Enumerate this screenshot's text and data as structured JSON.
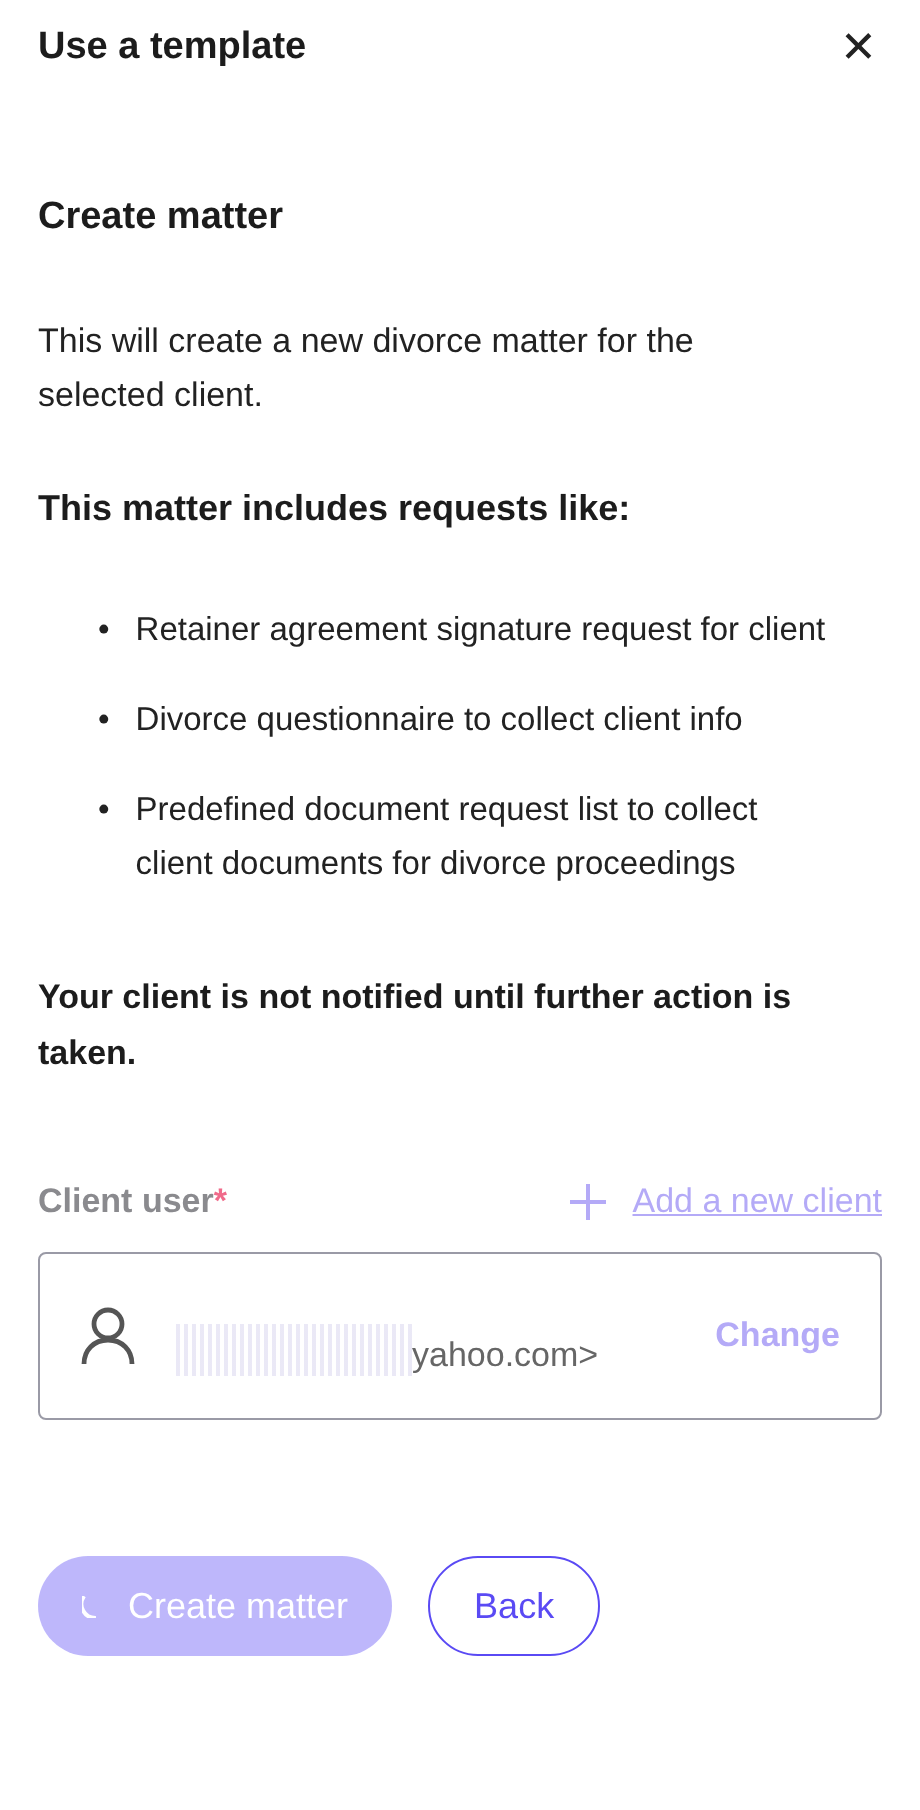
{
  "header": {
    "title": "Use a template",
    "close_icon": "✕"
  },
  "section_title": "Create matter",
  "description": "This will create a new divorce matter for the selected client.",
  "includes_heading": "This matter includes requests like:",
  "requests": [
    {
      "bullet": "•",
      "text": "Retainer agreement signature request for client"
    },
    {
      "bullet": "•",
      "text": "Divorce questionnaire to collect client info"
    },
    {
      "bullet": "•",
      "text": "Predefined document request list to collect client documents for divorce proceedings"
    }
  ],
  "notice": "Your client is not notified until further action is taken.",
  "client_field": {
    "label": "Client user",
    "required_mark": "*",
    "add_link": "Add a new client",
    "value": "yahoo.com>",
    "redacted": true,
    "change_link": "Change",
    "disabled": true
  },
  "buttons": [
    {
      "kind": "primary",
      "label": "Create matter",
      "loading": true,
      "disabled": true
    },
    {
      "kind": "secondary",
      "label": "Back",
      "loading": false,
      "disabled": false
    }
  ]
}
